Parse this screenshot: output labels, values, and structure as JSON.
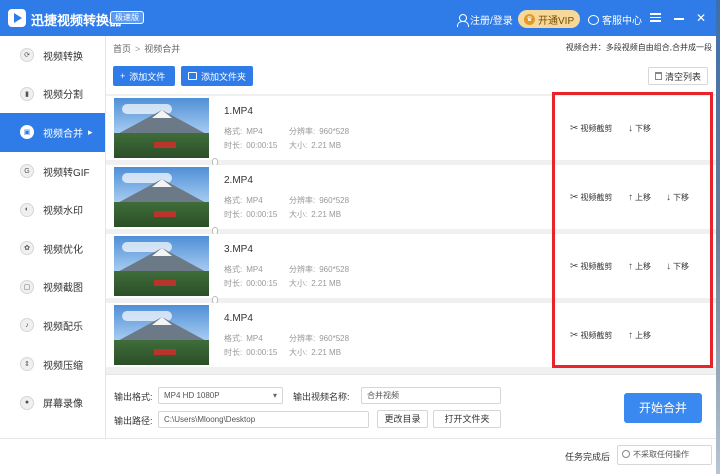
{
  "app": {
    "title": "迅捷视频转换器",
    "edition": "极速版",
    "login": "注册/登录",
    "vip": "开通VIP",
    "service": "客服中心"
  },
  "sidebar": {
    "items": [
      {
        "label": "视频转换",
        "icon": "refresh-icon"
      },
      {
        "label": "视频分割",
        "icon": "split-icon"
      },
      {
        "label": "视频合并",
        "icon": "merge-icon",
        "active": true
      },
      {
        "label": "视频转GIF",
        "icon": "gif-icon"
      },
      {
        "label": "视频水印",
        "icon": "watermark-icon"
      },
      {
        "label": "视频优化",
        "icon": "optimize-icon"
      },
      {
        "label": "视频截图",
        "icon": "screenshot-icon"
      },
      {
        "label": "视频配乐",
        "icon": "music-icon"
      },
      {
        "label": "视频压缩",
        "icon": "compress-icon"
      },
      {
        "label": "屏幕录像",
        "icon": "record-icon"
      }
    ],
    "active_arrow": "▸"
  },
  "breadcrumb": {
    "home": "首页",
    "sep": ">",
    "current": "视频合并"
  },
  "hint": "视频合并：多段视频自由组合,合并成一段",
  "toolbar": {
    "add_file": "添加文件",
    "add_folder": "添加文件夹",
    "clear_list": "清空列表"
  },
  "labels": {
    "format": "格式:",
    "resolution": "分辨率:",
    "duration": "时长:",
    "size": "大小:",
    "trim": "视频截剪",
    "up": "上移",
    "down": "下移"
  },
  "files": [
    {
      "name": "1.MP4",
      "format": "MP4",
      "resolution": "960*528",
      "duration": "00:00:15",
      "size": "2.21 MB"
    },
    {
      "name": "2.MP4",
      "format": "MP4",
      "resolution": "960*528",
      "duration": "00:00:15",
      "size": "2.21 MB"
    },
    {
      "name": "3.MP4",
      "format": "MP4",
      "resolution": "960*528",
      "duration": "00:00:15",
      "size": "2.21 MB"
    },
    {
      "name": "4.MP4",
      "format": "MP4",
      "resolution": "960*528",
      "duration": "00:00:15",
      "size": "2.21 MB"
    }
  ],
  "settings": {
    "output_format_label": "输出格式:",
    "output_format_value": "MP4  HD 1080P",
    "output_name_label": "输出视频名称:",
    "output_name_value": "合并视频",
    "output_path_label": "输出路径:",
    "output_path_value": "C:\\Users\\Mloong\\Desktop",
    "change_dir": "更改目录",
    "open_folder": "打开文件夹",
    "start": "开始合并"
  },
  "footer": {
    "task_done_label": "任务完成后",
    "task_done_value": "不采取任何操作"
  },
  "colors": {
    "accent": "#2f7ce8",
    "highlight": "#e8232a",
    "vip": "#f6d99a"
  }
}
